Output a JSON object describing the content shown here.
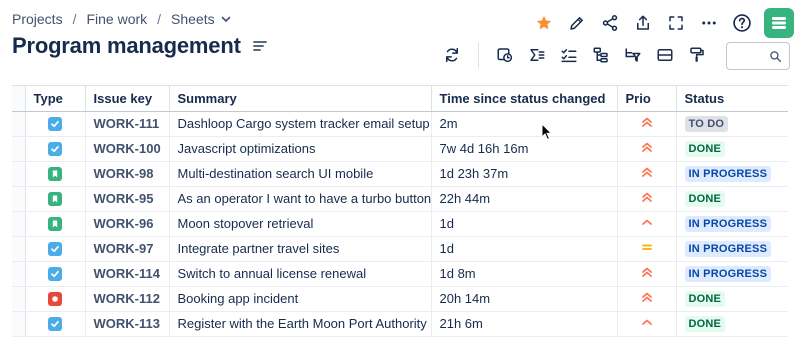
{
  "breadcrumb": {
    "items": [
      "Projects",
      "Fine work",
      "Sheets"
    ],
    "separator": "/"
  },
  "page": {
    "title": "Program management"
  },
  "colors": {
    "star": "#f79232",
    "brand": "#36b37e",
    "story": "#36b37e",
    "task": "#4bade8",
    "bug": "#e5493a",
    "prio_high": "#ff7452",
    "prio_medium": "#ffab00",
    "todo_bg": "#dfe1e6",
    "todo_fg": "#42526e",
    "done_bg": "#e3fcef",
    "done_fg": "#006644",
    "progress_bg": "#deebff",
    "progress_fg": "#0747a6"
  },
  "table": {
    "columns": [
      "Type",
      "Issue key",
      "Summary",
      "Time since status changed",
      "Prio",
      "Status"
    ],
    "rows": [
      {
        "type": "task-icon",
        "key": "WORK-111",
        "summary": "Dashloop Cargo system tracker email setup",
        "time": "2m",
        "prio": "high",
        "status": "TO DO"
      },
      {
        "type": "task-icon",
        "key": "WORK-100",
        "summary": "Javascript optimizations",
        "time": "7w 4d 16h 16m",
        "prio": "high",
        "status": "DONE"
      },
      {
        "type": "story-icon",
        "key": "WORK-98",
        "summary": "Multi-destination search UI mobile",
        "time": "1d 23h 37m",
        "prio": "high",
        "status": "IN PROGRESS"
      },
      {
        "type": "story-icon",
        "key": "WORK-95",
        "summary": "As an operator I want to have a turbo button",
        "time": "22h 44m",
        "prio": "high",
        "status": "DONE"
      },
      {
        "type": "story-icon",
        "key": "WORK-96",
        "summary": "Moon stopover retrieval",
        "time": "1d",
        "prio": "medium-high",
        "status": "IN PROGRESS"
      },
      {
        "type": "task-icon",
        "key": "WORK-97",
        "summary": "Integrate partner travel sites",
        "time": "1d",
        "prio": "medium",
        "status": "IN PROGRESS"
      },
      {
        "type": "task-icon",
        "key": "WORK-114",
        "summary": "Switch to annual license renewal",
        "time": "1d 8m",
        "prio": "high",
        "status": "IN PROGRESS"
      },
      {
        "type": "bug-icon",
        "key": "WORK-112",
        "summary": "Booking app incident",
        "time": "20h 14m",
        "prio": "high",
        "status": "DONE"
      },
      {
        "type": "task-icon",
        "key": "WORK-113",
        "summary": "Register with the Earth Moon Port Authority",
        "time": "21h 6m",
        "prio": "medium-high",
        "status": "DONE"
      }
    ]
  }
}
